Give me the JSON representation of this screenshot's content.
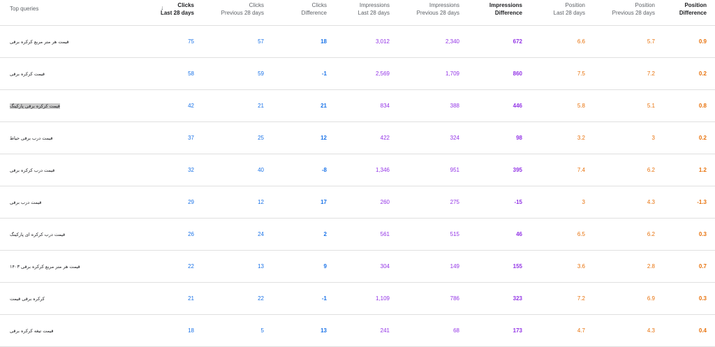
{
  "header": {
    "query": "Top queries",
    "clicks_last": [
      "Clicks",
      "Last 28 days"
    ],
    "clicks_prev": [
      "Clicks",
      "Previous 28 days"
    ],
    "clicks_diff": [
      "Clicks",
      "Difference"
    ],
    "impr_last": [
      "Impressions",
      "Last 28 days"
    ],
    "impr_prev": [
      "Impressions",
      "Previous 28 days"
    ],
    "impr_diff": [
      "Impressions",
      "Difference"
    ],
    "pos_last": [
      "Position",
      "Last 28 days"
    ],
    "pos_prev": [
      "Position",
      "Previous 28 days"
    ],
    "pos_diff": [
      "Position",
      "Difference"
    ],
    "sort_icon": "↓"
  },
  "colors": {
    "clicks": "#1a73e8",
    "impressions": "#9334e6",
    "position": "#e8710a"
  },
  "rows": [
    {
      "query": "قیمت هر متر مربع کرکره برقی",
      "c1": "75",
      "c2": "57",
      "cd": "18",
      "i1": "3,012",
      "i2": "2,340",
      "id": "672",
      "p1": "6.6",
      "p2": "5.7",
      "pd": "0.9"
    },
    {
      "query": "قیمت کرکره برقی",
      "c1": "58",
      "c2": "59",
      "cd": "-1",
      "i1": "2,569",
      "i2": "1,709",
      "id": "860",
      "p1": "7.5",
      "p2": "7.2",
      "pd": "0.2"
    },
    {
      "query": "قیمت کرکره برقی پارکینگ",
      "c1": "42",
      "c2": "21",
      "cd": "21",
      "i1": "834",
      "i2": "388",
      "id": "446",
      "p1": "5.8",
      "p2": "5.1",
      "pd": "0.8",
      "highlight": true
    },
    {
      "query": "قیمت درب برقی حیاط",
      "c1": "37",
      "c2": "25",
      "cd": "12",
      "i1": "422",
      "i2": "324",
      "id": "98",
      "p1": "3.2",
      "p2": "3",
      "pd": "0.2"
    },
    {
      "query": "قیمت درب کرکره برقی",
      "c1": "32",
      "c2": "40",
      "cd": "-8",
      "i1": "1,346",
      "i2": "951",
      "id": "395",
      "p1": "7.4",
      "p2": "6.2",
      "pd": "1.2"
    },
    {
      "query": "قیمت درب برقی",
      "c1": "29",
      "c2": "12",
      "cd": "17",
      "i1": "260",
      "i2": "275",
      "id": "-15",
      "p1": "3",
      "p2": "4.3",
      "pd": "-1.3"
    },
    {
      "query": "قیمت درب کرکره ای پارکینگ",
      "c1": "26",
      "c2": "24",
      "cd": "2",
      "i1": "561",
      "i2": "515",
      "id": "46",
      "p1": "6.5",
      "p2": "6.2",
      "pd": "0.3"
    },
    {
      "query": "قیمت هر متر مربع کرکره برقی ۱۴۰۳",
      "c1": "22",
      "c2": "13",
      "cd": "9",
      "i1": "304",
      "i2": "149",
      "id": "155",
      "p1": "3.6",
      "p2": "2.8",
      "pd": "0.7"
    },
    {
      "query": "کرکره برقی قیمت",
      "c1": "21",
      "c2": "22",
      "cd": "-1",
      "i1": "1,109",
      "i2": "786",
      "id": "323",
      "p1": "7.2",
      "p2": "6.9",
      "pd": "0.3"
    },
    {
      "query": "قیمت تیغه کرکره برقی",
      "c1": "18",
      "c2": "5",
      "cd": "13",
      "i1": "241",
      "i2": "68",
      "id": "173",
      "p1": "4.7",
      "p2": "4.3",
      "pd": "0.4"
    }
  ]
}
